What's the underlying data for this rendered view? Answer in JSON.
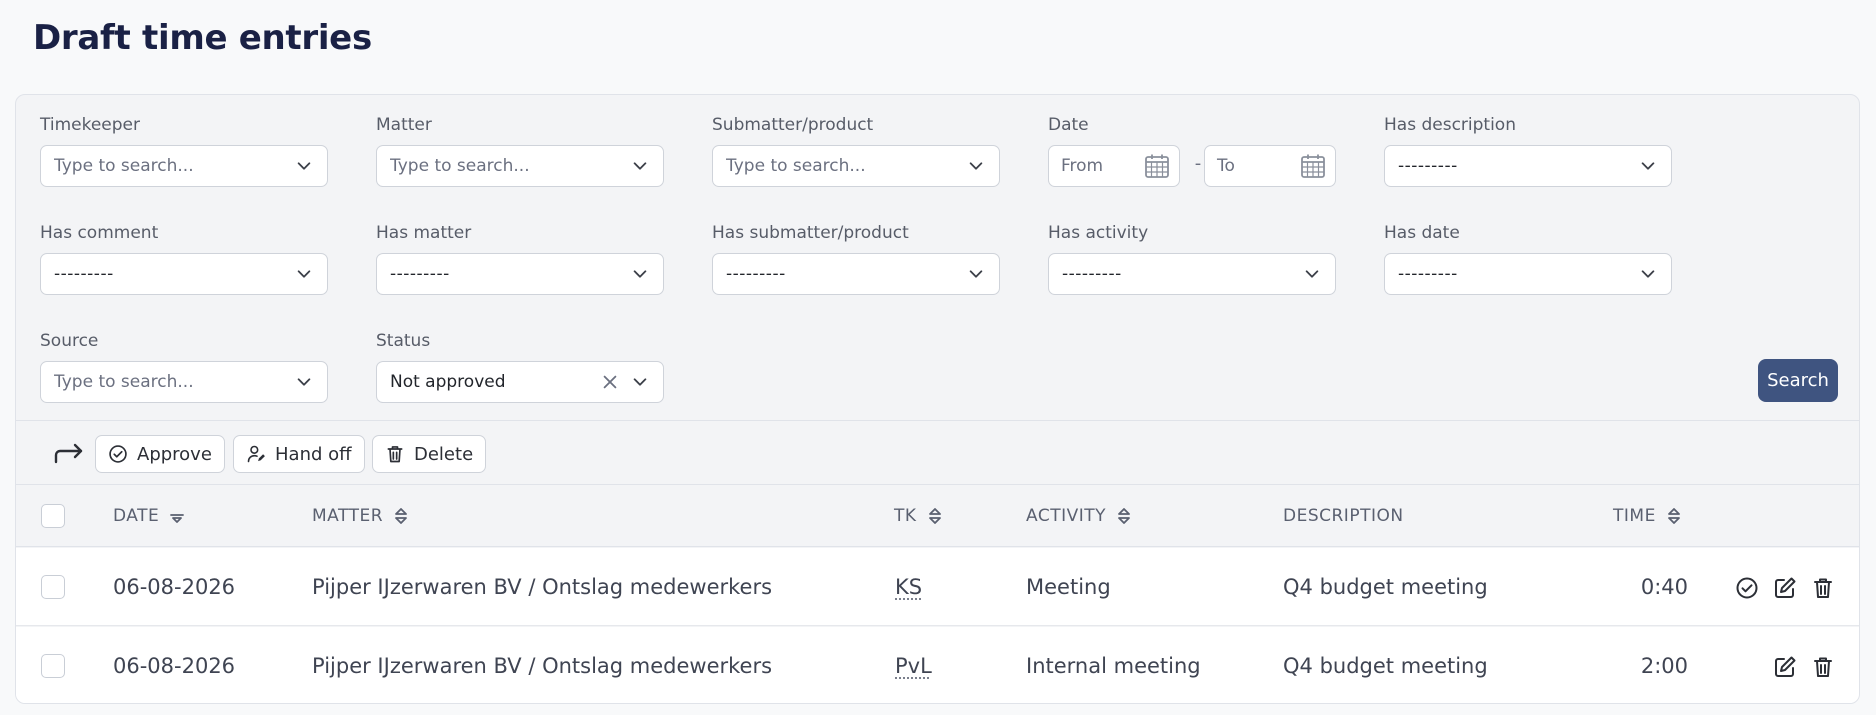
{
  "page": {
    "title": "Draft time entries"
  },
  "filters": {
    "timekeeper": {
      "label": "Timekeeper",
      "placeholder": "Type to search..."
    },
    "matter": {
      "label": "Matter",
      "placeholder": "Type to search..."
    },
    "submatter": {
      "label": "Submatter/product",
      "placeholder": "Type to search..."
    },
    "date": {
      "label": "Date",
      "from_placeholder": "From",
      "to_placeholder": "To",
      "separator": "-"
    },
    "has_description": {
      "label": "Has description",
      "value": "---------"
    },
    "has_comment": {
      "label": "Has comment",
      "value": "---------"
    },
    "has_matter": {
      "label": "Has matter",
      "value": "---------"
    },
    "has_submatter": {
      "label": "Has submatter/product",
      "value": "---------"
    },
    "has_activity": {
      "label": "Has activity",
      "value": "---------"
    },
    "has_date": {
      "label": "Has date",
      "value": "---------"
    },
    "source": {
      "label": "Source",
      "placeholder": "Type to search..."
    },
    "status": {
      "label": "Status",
      "value": "Not approved"
    },
    "search_label": "Search"
  },
  "toolbar": {
    "approve_label": "Approve",
    "handoff_label": "Hand off",
    "delete_label": "Delete"
  },
  "table": {
    "headers": {
      "date": "DATE",
      "matter": "MATTER",
      "tk": "TK",
      "activity": "ACTIVITY",
      "description": "DESCRIPTION",
      "time": "TIME"
    },
    "rows": [
      {
        "date": "06-08-2026",
        "matter": "Pijper IJzerwaren BV / Ontslag medewerkers",
        "tk": "KS",
        "activity": "Meeting",
        "description": "Q4 budget meeting",
        "time": "0:40",
        "can_approve": true
      },
      {
        "date": "06-08-2026",
        "matter": "Pijper IJzerwaren BV / Ontslag medewerkers",
        "tk": "PvL",
        "activity": "Internal meeting",
        "description": "Q4 budget meeting",
        "time": "2:00",
        "can_approve": false
      }
    ]
  },
  "icons": {
    "chevron": "chevron-down-icon",
    "calendar": "calendar-icon",
    "clear": "close-icon",
    "redo": "redo-arrow-icon",
    "approve": "check-circle-icon",
    "handoff": "user-edit-icon",
    "delete": "trash-icon",
    "edit": "pencil-square-icon",
    "sort": "sort-icon",
    "sort_desc": "sort-down-icon"
  },
  "colors": {
    "title": "#1a2145",
    "primary_button": "#3f5480"
  }
}
